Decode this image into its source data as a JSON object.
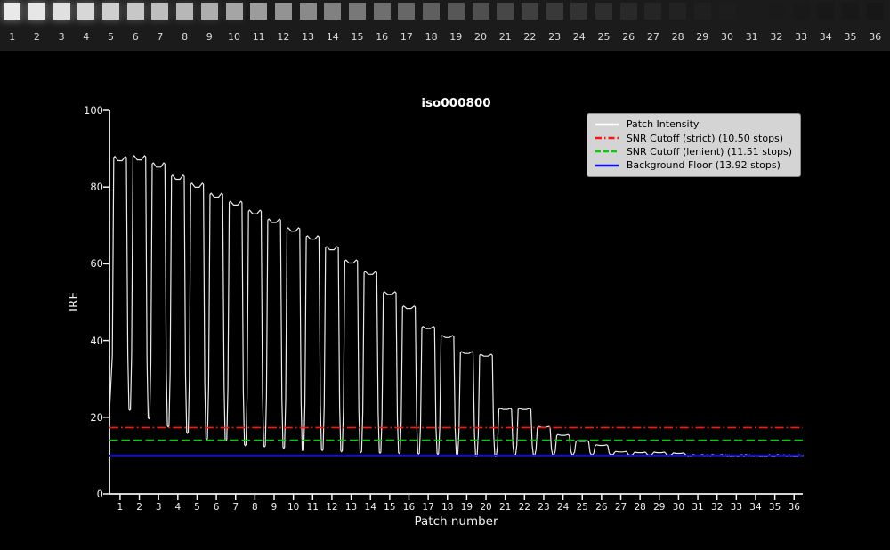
{
  "strip": {
    "background": "#1b1b1b",
    "patches": [
      {
        "n": 1,
        "hex": "#e9e9e9"
      },
      {
        "n": 2,
        "hex": "#e6e6e6"
      },
      {
        "n": 3,
        "hex": "#e0e0e0"
      },
      {
        "n": 4,
        "hex": "#d7d7d7"
      },
      {
        "n": 5,
        "hex": "#cfcfcf"
      },
      {
        "n": 6,
        "hex": "#c7c7c7"
      },
      {
        "n": 7,
        "hex": "#bfbfbf"
      },
      {
        "n": 8,
        "hex": "#b7b7b7"
      },
      {
        "n": 9,
        "hex": "#aeaeae"
      },
      {
        "n": 10,
        "hex": "#a5a5a5"
      },
      {
        "n": 11,
        "hex": "#9c9c9c"
      },
      {
        "n": 12,
        "hex": "#939393"
      },
      {
        "n": 13,
        "hex": "#8a8a8a"
      },
      {
        "n": 14,
        "hex": "#818181"
      },
      {
        "n": 15,
        "hex": "#787878"
      },
      {
        "n": 16,
        "hex": "#6f6f6f"
      },
      {
        "n": 17,
        "hex": "#676767"
      },
      {
        "n": 18,
        "hex": "#5f5f5f"
      },
      {
        "n": 19,
        "hex": "#575757"
      },
      {
        "n": 20,
        "hex": "#4f4f4f"
      },
      {
        "n": 21,
        "hex": "#474747"
      },
      {
        "n": 22,
        "hex": "#404040"
      },
      {
        "n": 23,
        "hex": "#393939"
      },
      {
        "n": 24,
        "hex": "#333333"
      },
      {
        "n": 25,
        "hex": "#2e2e2e"
      },
      {
        "n": 26,
        "hex": "#292929"
      },
      {
        "n": 27,
        "hex": "#252525"
      },
      {
        "n": 28,
        "hex": "#222222"
      },
      {
        "n": 29,
        "hex": "#1f1f1f"
      },
      {
        "n": 30,
        "hex": "#1d1d1d"
      },
      {
        "n": 31,
        "hex": "#1b1b1b"
      },
      {
        "n": 32,
        "hex": "#1a1a1a"
      },
      {
        "n": 33,
        "hex": "#191919"
      },
      {
        "n": 34,
        "hex": "#181818"
      },
      {
        "n": 35,
        "hex": "#181818"
      },
      {
        "n": 36,
        "hex": "#171717"
      }
    ]
  },
  "chart_data": {
    "type": "line",
    "title": "iso000800",
    "xlabel": "Patch number",
    "ylabel": "IRE",
    "xlim": [
      0.45,
      36.45
    ],
    "ylim": [
      0,
      100
    ],
    "yticks": [
      0,
      20,
      40,
      60,
      80,
      100
    ],
    "xticks": [
      1,
      2,
      3,
      4,
      5,
      6,
      7,
      8,
      9,
      10,
      11,
      12,
      13,
      14,
      15,
      16,
      17,
      18,
      19,
      20,
      21,
      22,
      23,
      24,
      25,
      26,
      27,
      28,
      29,
      30,
      31,
      32,
      33,
      34,
      35,
      36
    ],
    "grid": false,
    "background": "#000000",
    "legend_position": "upper right",
    "legend_background": "#d4d4d4",
    "series": [
      {
        "name": "Patch Intensity",
        "kind": "waveform",
        "color": "#ebebeb",
        "style": "solid",
        "peaks": [
          88.0,
          88.2,
          86.3,
          83.1,
          81.0,
          78.4,
          76.3,
          74.0,
          71.7,
          69.4,
          67.3,
          64.5,
          61.0,
          58.0,
          52.7,
          49.0,
          43.7,
          41.3,
          37.1,
          36.4,
          22.3,
          22.3,
          17.6,
          15.5,
          13.9,
          12.8,
          11.1,
          10.9,
          10.9,
          10.7,
          10.2,
          10.2,
          10.0,
          10.0,
          10.0,
          10.0
        ],
        "dips": [
          21.5,
          21.8,
          19.6,
          17.5,
          15.8,
          14.2,
          13.9,
          12.6,
          12.3,
          11.9,
          11.2,
          11.3,
          11.0,
          10.8,
          10.6,
          10.5,
          10.4,
          10.3,
          10.2,
          9.7,
          9.7,
          10.0,
          9.9,
          10.0,
          10.1,
          10.0,
          10.0,
          9.9,
          9.9,
          9.9,
          9.8,
          9.9,
          9.9,
          9.9,
          9.9,
          9.9,
          10.0
        ]
      },
      {
        "name": "SNR Cutoff (strict) (10.50 stops)",
        "kind": "hline",
        "value": 17.3,
        "color": "#ff1414",
        "style": "dashdot"
      },
      {
        "name": "SNR Cutoff (lenient) (11.51 stops)",
        "kind": "hline",
        "value": 14.0,
        "color": "#00d200",
        "style": "dashed"
      },
      {
        "name": "Background Floor (13.92 stops)",
        "kind": "hline",
        "value": 10.0,
        "color": "#0a0aff",
        "style": "solid"
      }
    ]
  }
}
